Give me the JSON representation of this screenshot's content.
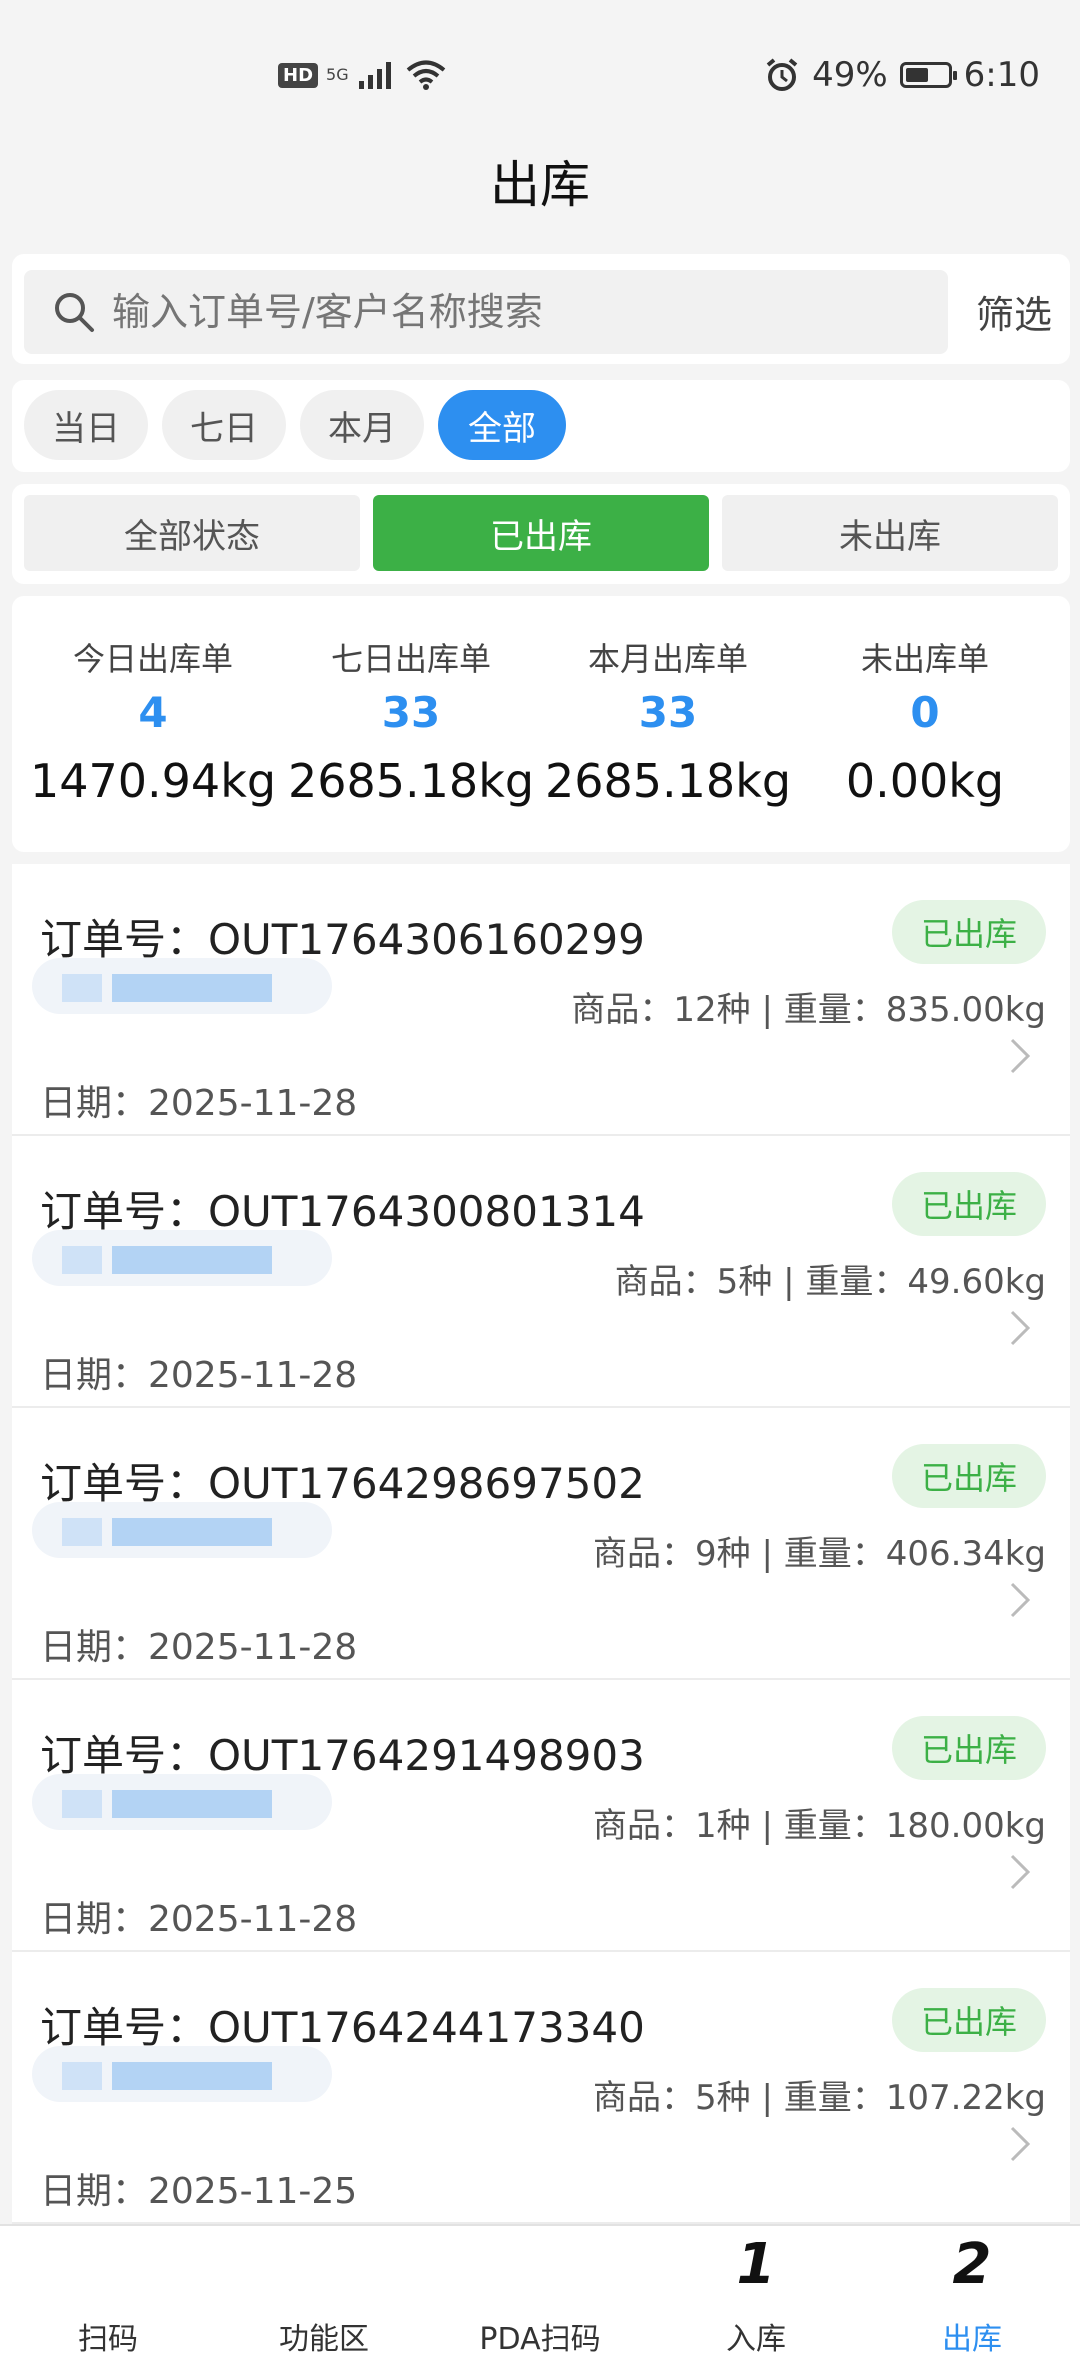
{
  "status_bar": {
    "hd": "HD",
    "net": "5G",
    "battery": "49%",
    "time": "6:10"
  },
  "page_title": "出库",
  "search": {
    "placeholder": "输入订单号/客户名称搜索",
    "filter_label": "筛选"
  },
  "date_tabs": [
    "当日",
    "七日",
    "本月",
    "全部"
  ],
  "status_tabs": [
    "全部状态",
    "已出库",
    "未出库"
  ],
  "stats": [
    {
      "label": "今日出库单",
      "count": "4",
      "weight": "1470.94kg"
    },
    {
      "label": "七日出库单",
      "count": "33",
      "weight": "2685.18kg"
    },
    {
      "label": "本月出库单",
      "count": "33",
      "weight": "2685.18kg"
    },
    {
      "label": "未出库单",
      "count": "0",
      "weight": "0.00kg"
    }
  ],
  "orders": [
    {
      "order_no": "订单号：OUT1764306160299",
      "status": "已出库",
      "summary": "商品：12种 | 重量：835.00kg",
      "date": "日期：2025-11-28"
    },
    {
      "order_no": "订单号：OUT1764300801314",
      "status": "已出库",
      "summary": "商品：5种 | 重量：49.60kg",
      "date": "日期：2025-11-28"
    },
    {
      "order_no": "订单号：OUT1764298697502",
      "status": "已出库",
      "summary": "商品：9种 | 重量：406.34kg",
      "date": "日期：2025-11-28"
    },
    {
      "order_no": "订单号：OUT1764291498903",
      "status": "已出库",
      "summary": "商品：1种 | 重量：180.00kg",
      "date": "日期：2025-11-28"
    },
    {
      "order_no": "订单号：OUT1764244173340",
      "status": "已出库",
      "summary": "商品：5种 | 重量：107.22kg",
      "date": "日期：2025-11-25"
    }
  ],
  "bottom_nav": [
    {
      "label": "扫码",
      "num": ""
    },
    {
      "label": "功能区",
      "num": ""
    },
    {
      "label": "PDA扫码",
      "num": ""
    },
    {
      "label": "入库",
      "num": "1"
    },
    {
      "label": "出库",
      "num": "2"
    }
  ],
  "colors": {
    "accent": "#2d8ff0",
    "success": "#3cb046",
    "badge_bg": "#e4f4e4"
  }
}
